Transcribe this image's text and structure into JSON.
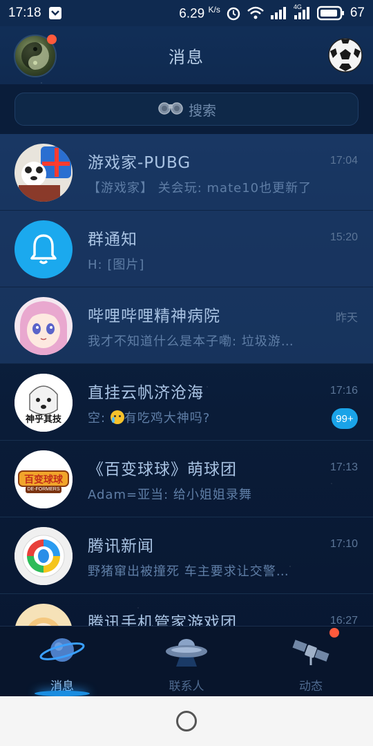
{
  "status_bar": {
    "time": "17:18",
    "speed": "6.29",
    "speed_unit": "K/s",
    "network": "4G",
    "battery": "67"
  },
  "header": {
    "title": "消息"
  },
  "search": {
    "placeholder": "搜索"
  },
  "conversations": [
    {
      "name": "游戏家-PUBG",
      "message": "【游戏家】 关会玩: mate10也更新了",
      "time": "17:04",
      "pinned": true,
      "badge": ""
    },
    {
      "name": "群通知",
      "message": "H: [图片]",
      "time": "15:20",
      "pinned": true,
      "badge": ""
    },
    {
      "name": "哔哩哔哩精神病院",
      "message": "我才不知道什么是本子嘞: 垃圾游…",
      "time": "昨天",
      "pinned": true,
      "badge": ""
    },
    {
      "name": "直挂云帆济沧海",
      "message_prefix": "空: ",
      "message": "有吃鸡大神吗?",
      "time": "17:16",
      "pinned": false,
      "badge": "99+"
    },
    {
      "name": "《百变球球》萌球团",
      "message": "Adam=亚当: 给小姐姐录舞",
      "time": "17:13",
      "pinned": false,
      "badge": ""
    },
    {
      "name": "腾讯新闻",
      "message": "野猪窜出被撞死 车主要求让交警…",
      "time": "17:10",
      "pinned": false,
      "badge": ""
    },
    {
      "name": "腾讯手机管家游戏团",
      "message": "",
      "time": "16:27",
      "pinned": false,
      "badge": ""
    }
  ],
  "avatar_texts": {
    "zhihu_jiji": "神乎其技",
    "baibian": "百变球球",
    "deformers": "DE-FORMERS"
  },
  "bottom_nav": {
    "items": [
      {
        "label": "消息",
        "icon": "planet-icon",
        "active": true
      },
      {
        "label": "联系人",
        "icon": "ufo-icon",
        "active": false
      },
      {
        "label": "动态",
        "icon": "satellite-icon",
        "active": false
      }
    ]
  },
  "colors": {
    "accent": "#1aa3e8",
    "notification_dot": "#ff5a3c",
    "background": "#0b1a33"
  }
}
